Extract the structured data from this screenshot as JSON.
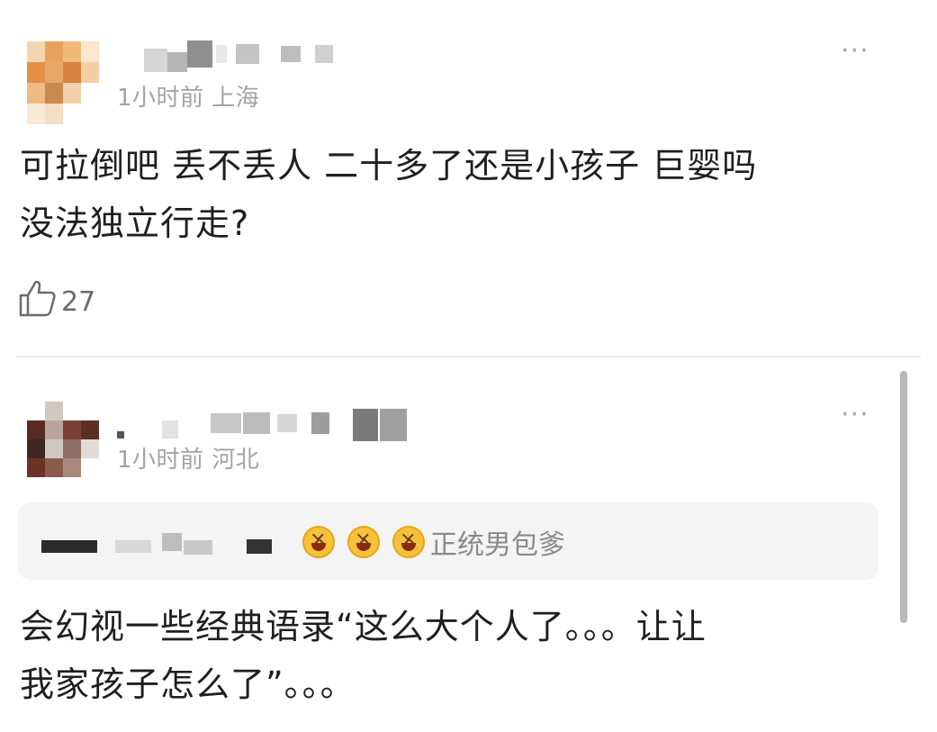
{
  "comments": [
    {
      "time_location": "1小时前 上海",
      "more_label": "···",
      "text_line1": "可拉倒吧 丢不丢人 二十多了还是小孩子 巨婴吗",
      "text_line2": "没法独立行走?",
      "like_icon": "thumbs-up-icon",
      "like_count": "27"
    },
    {
      "time_location": "1小时前 河北",
      "more_label": "···",
      "quote_suffix": "正统男包爹",
      "text_line1": "会幻视一些经典语录“这么大个人了。。。让让",
      "text_line2": "我家孩子怎么了”。。。"
    }
  ],
  "colors": {
    "meta": "#a3a3a3",
    "text": "#1f1f1f",
    "quote_bg": "#f4f4f4",
    "emoji": "#f7c23b"
  }
}
